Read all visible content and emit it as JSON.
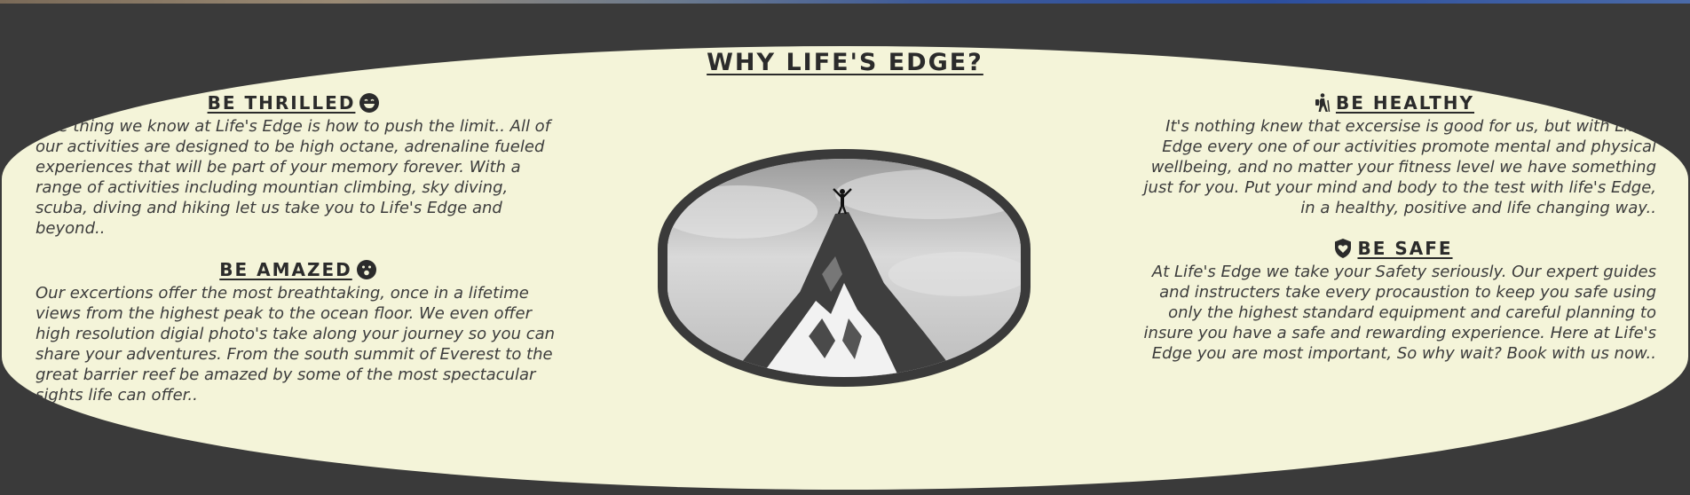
{
  "section": {
    "title": "WHY LIFE'S EDGE?"
  },
  "features": {
    "thrilled": {
      "heading": "BE THRILLED",
      "icon": "grin-icon",
      "text": "One thing we know at Life's Edge is how to push the limit.. All of our activities are designed to be high octane, adrenaline fueled experiences that will be part of your memory forever. With a range of activities including mountian climbing, sky diving, scuba, diving and hiking let us take you to Life's Edge and beyond.."
    },
    "amazed": {
      "heading": "BE AMAZED",
      "icon": "surprised-icon",
      "text": "Our excertions offer the most breathtaking, once in a lifetime views from the highest peak to the ocean floor. We even offer high resolution digial photo's take along your journey so you can share your adventures. From the south summit of Everest to the great barrier reef be amazed by some of the most spectacular sights life can offer.."
    },
    "healthy": {
      "heading": "BE HEALTHY",
      "icon": "hiking-icon",
      "text": "It's nothing knew that excersise is good for us, but with Life's Edge every one of our activities promote mental and physical wellbeing, and no matter your fitness level we have something just for you. Put your mind and body to the test with life's Edge, in a healthy, positive and life changing way.."
    },
    "safe": {
      "heading": "BE SAFE",
      "icon": "shield-heart-icon",
      "text": "At Life's Edge we take your Safety seriously. Our expert guides and instructers take every procaustion to keep you safe using only the highest standard equipment and careful planning to insure you have a safe and rewarding experience. Here at Life's Edge you are most important, So why wait? Book with us now.."
    }
  },
  "colors": {
    "background": "#3a3a3a",
    "panel": "#f4f4d9",
    "text": "#2b2b2b"
  }
}
